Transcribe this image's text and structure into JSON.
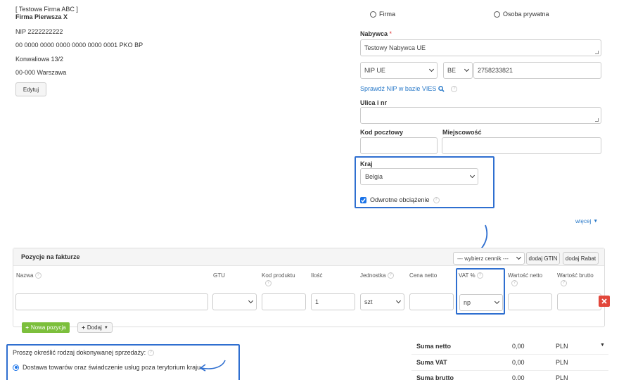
{
  "seller": {
    "top_line": "[ Testowa Firma ABC ]",
    "name": "Firma Pierwsza X",
    "nip": "NIP 2222222222",
    "account": "00 0000 0000 0000 0000 0000 0001 PKO BP",
    "street": "Konwaliowa 13/2",
    "city": "00-000 Warszawa",
    "edit_label": "Edytuj"
  },
  "buyer_type": {
    "option_company": "Firma",
    "option_private": "Osoba prywatna"
  },
  "buyer": {
    "label": "Nabywca",
    "required_mark": "*",
    "name_value": "Testowy Nabywca UE",
    "nip_type": "NIP UE",
    "country_code": "BE",
    "nip_value": "2758233821",
    "vies_link": "Sprawdź NIP w bazie VIES",
    "street_label": "Ulica i nr",
    "postcode_label": "Kod pocztowy",
    "city_label": "Miejscowość",
    "country_label": "Kraj",
    "country_value": "Belgia",
    "reverse_charge_label": "Odwrotne obciążenie",
    "more_link": "więcej"
  },
  "positions": {
    "title": "Pozycje na fakturze",
    "pricelist_select": "--- wybierz cennik ---",
    "add_gtin": "dodaj GTIN",
    "add_discount": "dodaj Rabat",
    "columns": [
      "Nazwa",
      "GTU",
      "Kod produktu",
      "Ilość",
      "Jednostka",
      "Cena netto",
      "VAT %",
      "Wartość netto",
      "Wartość brutto"
    ],
    "row": {
      "quantity": "1",
      "unit": "szt",
      "vat": "np"
    },
    "new_position_label": "Nowa pozycja",
    "add_label": "Dodaj"
  },
  "sale_type": {
    "prompt": "Proszę określić rodzaj dokonywanej sprzedaży:",
    "option_1": "Dostawa towarów oraz świadczenie usług poza terytorium kraju"
  },
  "totals": {
    "rows": [
      {
        "label": "Suma netto",
        "value": "0,00",
        "currency": "PLN"
      },
      {
        "label": "Suma VAT",
        "value": "0,00",
        "currency": "PLN"
      },
      {
        "label": "Suma brutto",
        "value": "0,00",
        "currency": "PLN"
      }
    ]
  },
  "colors": {
    "highlight": "#2f6fd0",
    "link": "#2a7ac9",
    "green": "#7cbf3c",
    "red": "#e2473b"
  }
}
